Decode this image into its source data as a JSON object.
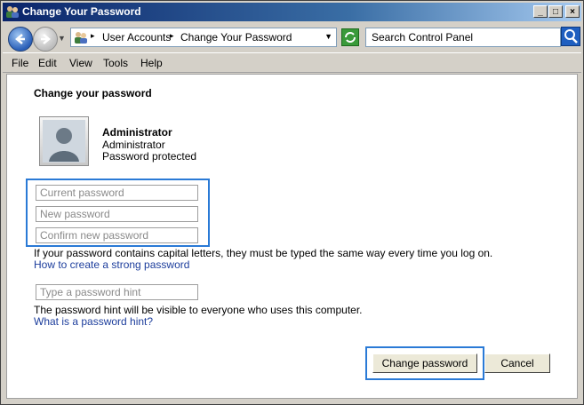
{
  "window": {
    "title": "Change Your Password",
    "controls": {
      "minimize": "_",
      "maximize": "□",
      "close": "×"
    }
  },
  "address_bar": {
    "breadcrumbs": [
      "User Accounts",
      "Change Your Password"
    ],
    "icon": "control-panel-icon"
  },
  "search": {
    "placeholder": "Search Control Panel"
  },
  "menu": [
    "File",
    "Edit",
    "View",
    "Tools",
    "Help"
  ],
  "content": {
    "heading": "Change your password",
    "user": {
      "name": "Administrator",
      "role": "Administrator",
      "status": "Password protected"
    },
    "fields": {
      "current_password": "Current password",
      "new_password": "New password",
      "confirm_password": "Confirm new password",
      "hint": "Type a password hint"
    },
    "caps_note": "If your password contains capital letters, they must be typed the same way every time you log on.",
    "strong_password_link": "How to create a strong password",
    "hint_note": "The password hint will be visible to everyone who uses this computer.",
    "hint_link": "What is a password hint?",
    "buttons": {
      "change": "Change password",
      "cancel": "Cancel"
    }
  },
  "colors": {
    "accent": "#2a7ad6",
    "link": "#1c3d9c",
    "titlebar": "#0a246a"
  }
}
